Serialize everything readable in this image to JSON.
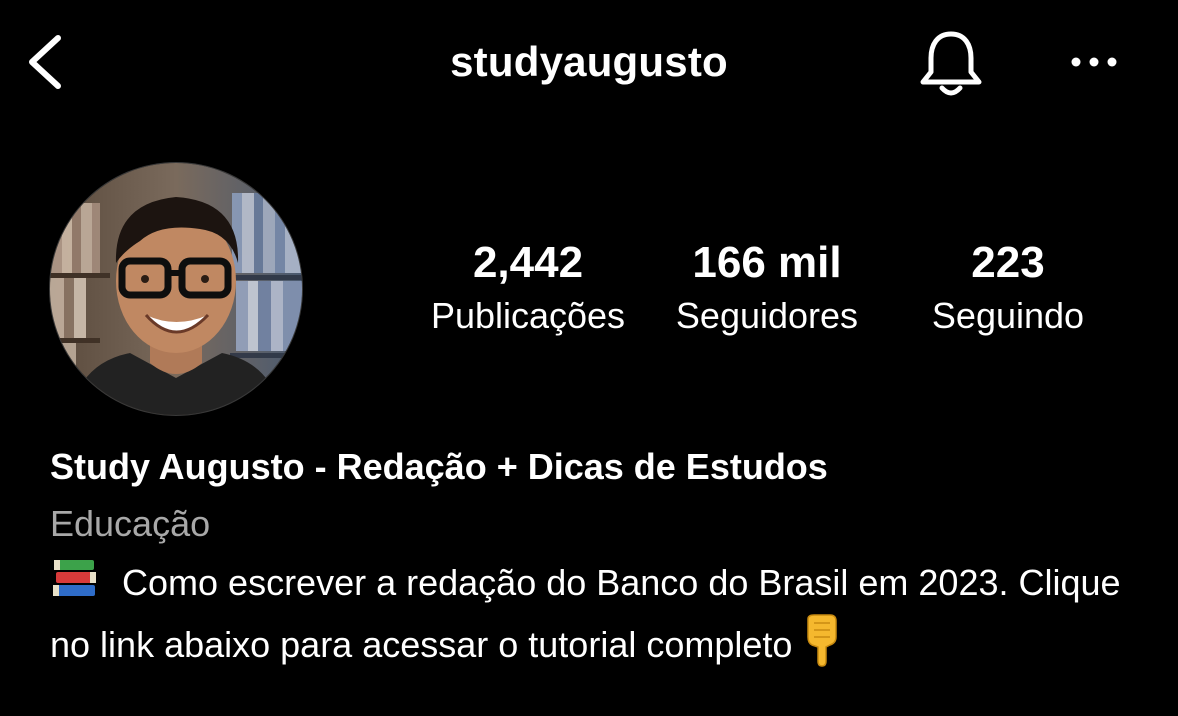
{
  "header": {
    "username": "studyaugusto",
    "back_icon": "chevron-left-icon",
    "bell_icon": "bell-icon",
    "more_icon": "more-horizontal-icon"
  },
  "stats": [
    {
      "value": "2,442",
      "label": "Publicações"
    },
    {
      "value": "166 mil",
      "label": "Seguidores"
    },
    {
      "value": "223",
      "label": "Seguindo"
    }
  ],
  "bio": {
    "display_name": "Study Augusto - Redação + Dicas de Estudos",
    "category": "Educação",
    "lead_emoji": "books-emoji",
    "text": "Como escrever a redação do Banco do Brasil em 2023. Clique no link abaixo para acessar o tutorial completo",
    "trail_emoji": "pointing-down-hand-emoji"
  },
  "colors": {
    "background": "#000000",
    "text": "#ffffff",
    "secondary_text": "#a8a8a8"
  }
}
